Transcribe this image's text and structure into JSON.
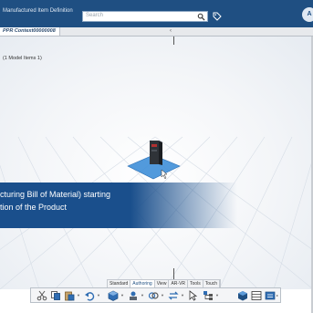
{
  "header": {
    "app_title": "Manufactured Item Definition",
    "search_placeholder": "Search",
    "user_initials": "A"
  },
  "tabs": [
    {
      "label": "PPR Context00000008"
    }
  ],
  "tree": {
    "root_label": "(1 Model Items 1)"
  },
  "caption": {
    "line1": "cturing Bill of Material) starting",
    "line2": "tion of the Product"
  },
  "ribbon": {
    "tabs": [
      "Standard",
      "Authoring",
      "View",
      "AR-VR",
      "Tools",
      "Touch"
    ],
    "active_tab": "Authoring"
  },
  "toolbar": {
    "icons": [
      "cut-icon",
      "copy-icon",
      "paste-icon",
      "undo-icon",
      "product-icon",
      "manufacturing-assembly-icon",
      "link-icon",
      "refresh-icon",
      "cube-icon",
      "grid-icon",
      "list-icon",
      "settings-icon"
    ]
  },
  "colors": {
    "header_bg": "#1f4f82",
    "caption_bg": "#1a4f8c",
    "model_plane": "#3f8fd8"
  }
}
